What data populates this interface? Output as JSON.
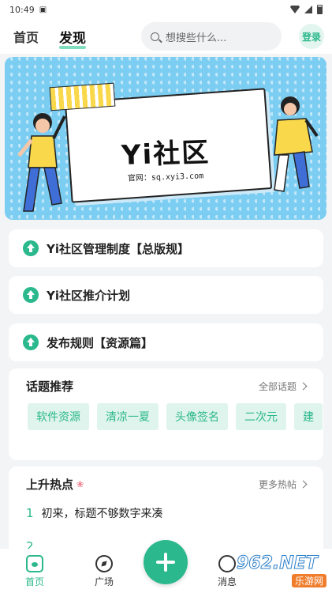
{
  "status": {
    "time": "10:49"
  },
  "header": {
    "tabs": [
      {
        "label": "首页"
      },
      {
        "label": "发现"
      }
    ],
    "search_placeholder": "想搜些什么...",
    "login_label": "登录"
  },
  "banner": {
    "title": "Yi社区",
    "subtitle": "官网：sq.xyi3.com",
    "slides_total": 2,
    "slide_active": 1
  },
  "notices": [
    {
      "label": "Yi社区管理制度【总版规】"
    },
    {
      "label": "Yi社区推介计划"
    },
    {
      "label": "发布规则【资源篇】"
    }
  ],
  "topics": {
    "title": "话题推荐",
    "more": "全部话题",
    "tags": [
      "软件资源",
      "清凉一夏",
      "头像签名",
      "二次元",
      "建"
    ]
  },
  "hot": {
    "title": "上升热点",
    "more": "更多热帖",
    "items": [
      {
        "num": "1",
        "text": "初来，标题不够数字来凑"
      },
      {
        "num": "2",
        "text": ""
      }
    ]
  },
  "bottom_nav": {
    "items": [
      {
        "label": "首页"
      },
      {
        "label": "广场"
      },
      {
        "label": "消息"
      }
    ]
  },
  "watermark": {
    "text": "962.NET",
    "sub": "乐游网"
  },
  "colors": {
    "accent": "#2bb88c",
    "banner_bg": "#7ccdf2",
    "tag_bg": "#dff4ec"
  }
}
